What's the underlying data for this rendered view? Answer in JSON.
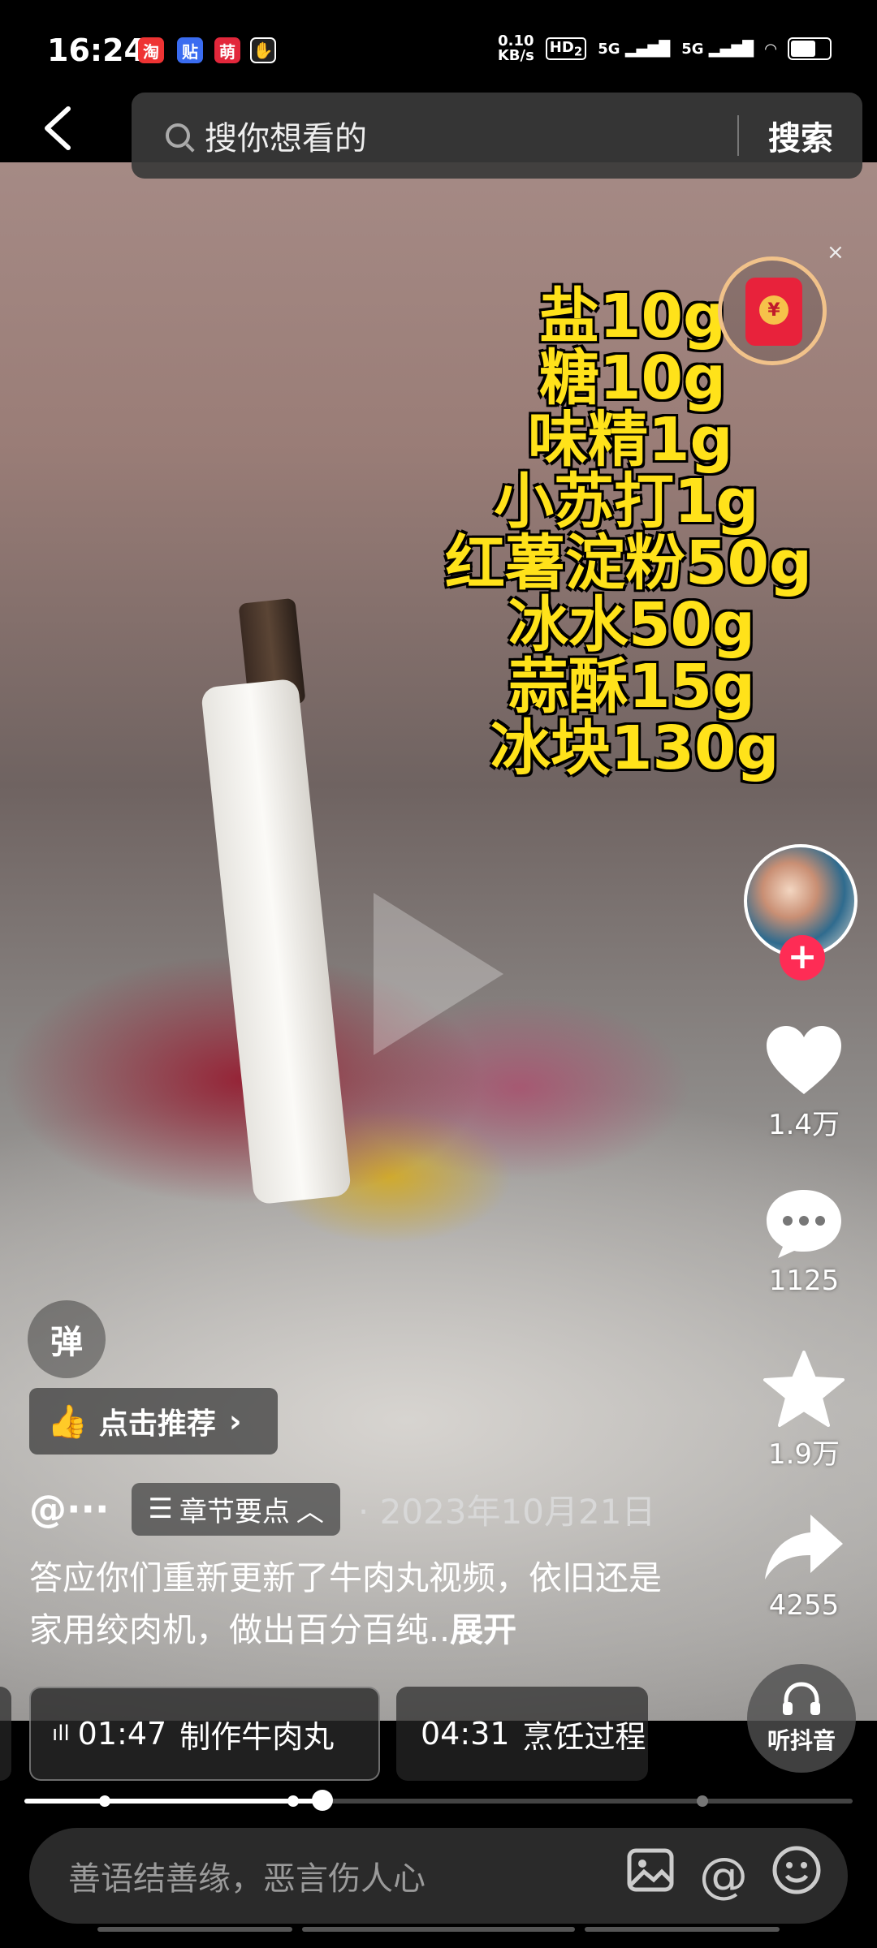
{
  "status_bar": {
    "time": "16:24",
    "app_icons": [
      "淘",
      "贴",
      "萌",
      "✋"
    ],
    "net_speed_value": "0.10",
    "net_speed_unit": "KB/s",
    "hd_badge": "HD",
    "hd_sub": "2",
    "signal1": "5G",
    "signal2": "5G"
  },
  "search": {
    "placeholder": "搜你想看的",
    "button": "搜索"
  },
  "overlay": {
    "ingredients": [
      "盐10g",
      "糖10g",
      "味精1g",
      "小苏打1g",
      "红薯淀粉50g",
      "冰水50g",
      "蒜酥15g",
      "冰块130g"
    ],
    "redpacket_symbol": "¥",
    "close": "×"
  },
  "actions": {
    "follow": "+",
    "likes": "1.4万",
    "comments": "1125",
    "favorites": "1.9万",
    "shares": "4255"
  },
  "bottom": {
    "danmu_label": "弹",
    "recommend_label": "点击推荐",
    "author": "@···",
    "chapters_label": "章节要点",
    "date_sep": "·",
    "date": "2023年10月21日",
    "description": "答应你们重新更新了牛肉丸视频，依旧还是家用绞肉机，做出百分百纯..",
    "expand": "展开",
    "chapters": [
      {
        "time": "01:47",
        "title": "制作牛肉丸"
      },
      {
        "time": "04:31",
        "title": "烹饪过程"
      }
    ],
    "listen_label": "听抖音",
    "progress": 0.36,
    "comment_placeholder": "善语结善缘，恶言伤人心"
  },
  "colors": {
    "ingredient_text": "#ffe21a",
    "follow": "#fe2c55",
    "redpacket": "#e8223b"
  }
}
